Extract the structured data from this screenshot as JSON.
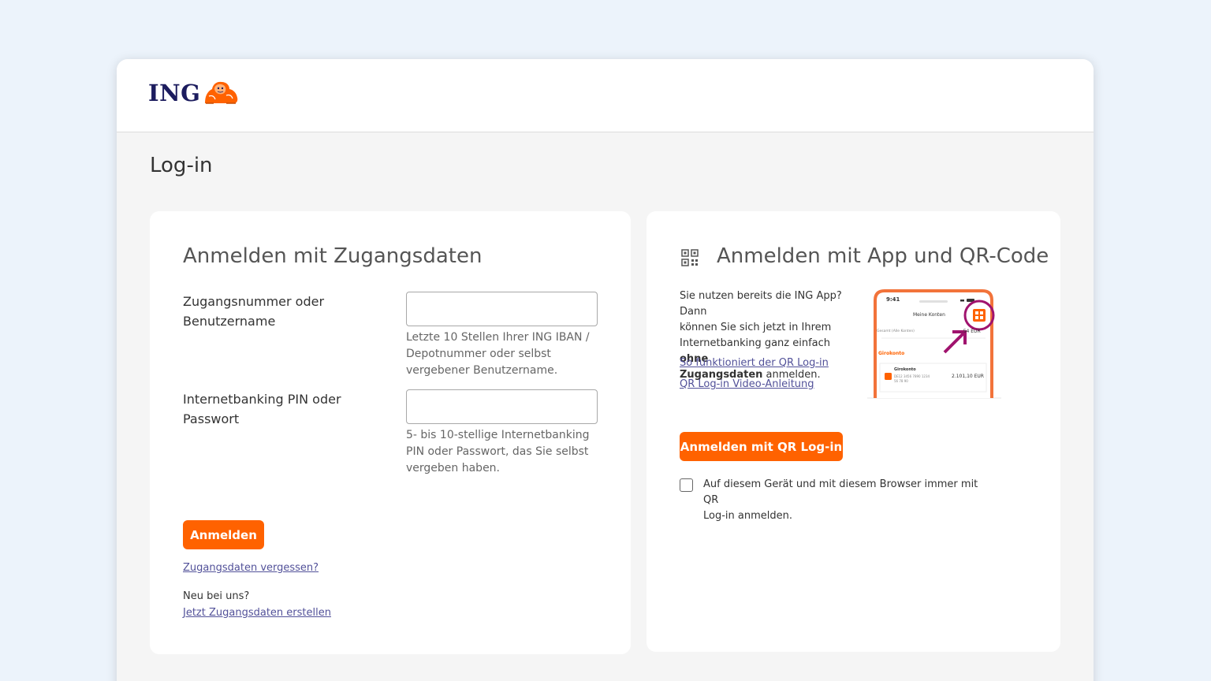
{
  "brand": {
    "name": "ING",
    "logo_icon": "lion-icon",
    "accent_color": "#ff6200",
    "navy_color": "#1c1c5e"
  },
  "page": {
    "title": "Log-in"
  },
  "credentials": {
    "title": "Anmelden mit Zugangsdaten",
    "username": {
      "label_line1": "Zugangsnummer oder",
      "label_line2": "Benutzername",
      "value": "",
      "hint_line1": "Letzte 10 Stellen Ihrer ING IBAN /",
      "hint_line2": "Depotnummer oder selbst",
      "hint_line3": "vergebener Benutzername."
    },
    "pin": {
      "label_line1": "Internetbanking PIN oder",
      "label_line2": "Passwort",
      "value": "",
      "hint_line1": "5- bis 10-stellige Internetbanking",
      "hint_line2": "PIN oder Passwort, das Sie selbst",
      "hint_line3": "vergeben haben."
    },
    "submit_label": "Anmelden",
    "forgot_link": "Zugangsdaten vergessen?",
    "new_label": "Neu bei uns?",
    "create_link": "Jetzt Zugangsdaten erstellen"
  },
  "qr": {
    "icon": "qr-code-icon",
    "title": "Anmelden mit App und QR-Code",
    "desc_line1": "Sie nutzen bereits die ING App? Dann",
    "desc_line2": "können Sie sich jetzt in Ihrem",
    "desc_line3_a": "Internetbanking ganz einfach ",
    "desc_line3_b": "ohne",
    "desc_line4_a": "Zugangsdaten",
    "desc_line4_b": " anmelden.",
    "link_how": "So funktioniert der QR Log-in",
    "link_video": "QR Log-in Video-Anleitung",
    "button_label": "Anmelden mit QR Log-in",
    "remember_checked": false,
    "remember_line1": "Auf diesem Gerät und mit diesem Browser immer mit QR",
    "remember_line2": "Log-in anmelden.",
    "phone": {
      "time": "9:41",
      "screen_title": "Meine Konten",
      "filter": "Gesamt (Alle Konten)",
      "total": "...54 EUR",
      "section": "Girokonto",
      "account_name": "Girokonto",
      "iban_line1": "DE12 3456 7890 1234",
      "iban_line2": "56 78 90",
      "balance": "2.101,10 EUR",
      "highlight_color": "#a0136e"
    }
  }
}
